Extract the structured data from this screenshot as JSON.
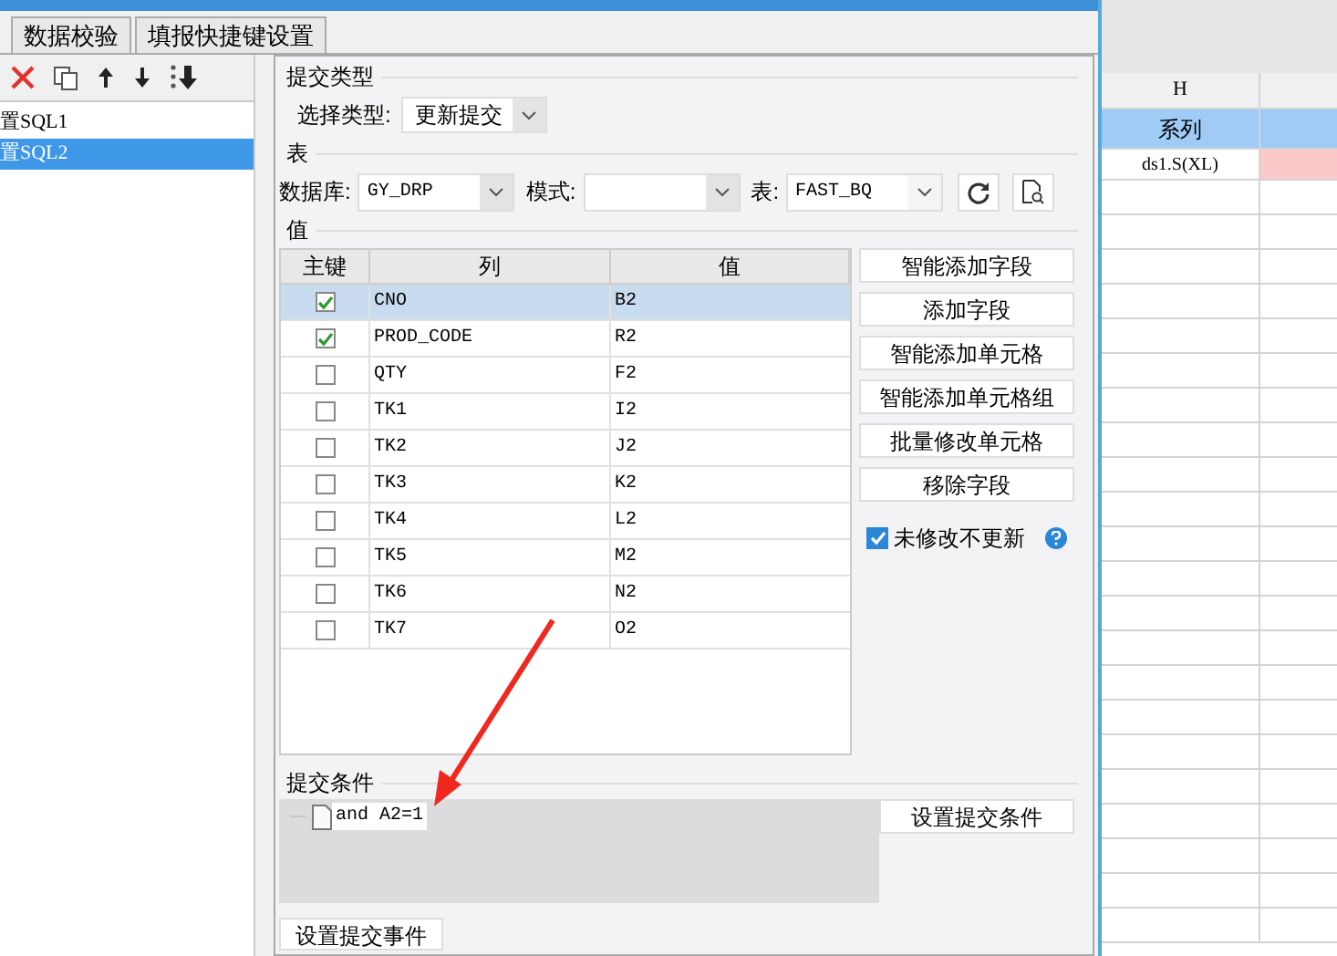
{
  "tabs": [
    {
      "label": "数据校验",
      "selected": false
    },
    {
      "label": "填报快捷键设置",
      "selected": false
    }
  ],
  "sidebar": {
    "items": [
      {
        "label": "置SQL1",
        "selected": false
      },
      {
        "label": "置SQL2",
        "selected": true
      }
    ]
  },
  "submit_type": {
    "title": "提交类型",
    "label": "选择类型:",
    "value": "更新提交"
  },
  "table_section": {
    "title": "表",
    "database_label": "数据库:",
    "database": "GY_DRP",
    "schema_label": "模式:",
    "table_label": "表:",
    "table": "FAST_BQ"
  },
  "values": {
    "title": "值",
    "columns": [
      "主键",
      "列",
      "值"
    ],
    "rows": [
      {
        "key": true,
        "column": "CNO",
        "value": "B2",
        "selected": true
      },
      {
        "key": true,
        "column": "PROD_CODE",
        "value": "R2",
        "selected": false
      },
      {
        "key": false,
        "column": "QTY",
        "value": "F2",
        "selected": false
      },
      {
        "key": false,
        "column": "TK1",
        "value": "I2",
        "selected": false
      },
      {
        "key": false,
        "column": "TK2",
        "value": "J2",
        "selected": false
      },
      {
        "key": false,
        "column": "TK3",
        "value": "K2",
        "selected": false
      },
      {
        "key": false,
        "column": "TK4",
        "value": "L2",
        "selected": false
      },
      {
        "key": false,
        "column": "TK5",
        "value": "M2",
        "selected": false
      },
      {
        "key": false,
        "column": "TK6",
        "value": "N2",
        "selected": false
      },
      {
        "key": false,
        "column": "TK7",
        "value": "O2",
        "selected": false
      }
    ],
    "buttons": [
      "智能添加字段",
      "添加字段",
      "智能添加单元格",
      "智能添加单元格组",
      "批量修改单元格",
      "移除字段"
    ],
    "no_update_unchanged": {
      "label": "未修改不更新",
      "checked": true
    }
  },
  "condition": {
    "title": "提交条件",
    "item": "and A2=1",
    "button": "设置提交条件"
  },
  "event_button": "设置提交事件",
  "sheet": {
    "column": "H",
    "header": "系列",
    "cell": "ds1.S(XL)"
  }
}
